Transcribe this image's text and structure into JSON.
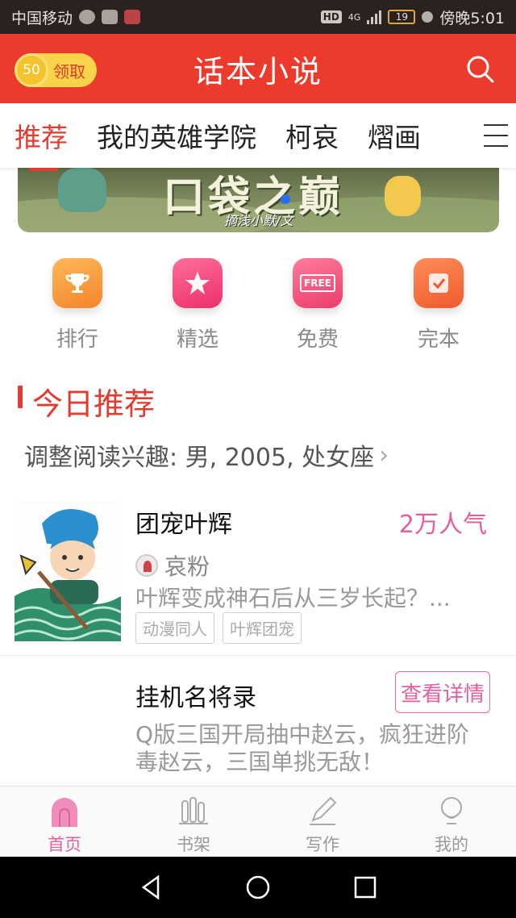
{
  "status_bar": {
    "carrier": "中国移动",
    "network": "4G",
    "hd_label": "HD",
    "battery": "19",
    "time": "傍晚5:01"
  },
  "header": {
    "coins": "50",
    "coin_action": "领取",
    "title": "话本小说",
    "search_icon": "search-icon"
  },
  "tabs": [
    {
      "label": "推荐",
      "active": true
    },
    {
      "label": "我的英雄学院",
      "active": false
    },
    {
      "label": "柯哀",
      "active": false
    },
    {
      "label": "熠画",
      "active": false
    }
  ],
  "banner": {
    "title": "口袋之巅",
    "subtitle": "摘浅小默/文"
  },
  "categories": [
    {
      "label": "排行",
      "icon": "trophy-icon",
      "color": "#f79a3a"
    },
    {
      "label": "精选",
      "icon": "star-icon",
      "color": "#f0467c"
    },
    {
      "label": "免费",
      "icon": "free-icon",
      "icon_text": "FREE",
      "color": "#f04f78"
    },
    {
      "label": "完本",
      "icon": "checklist-icon",
      "color": "#f06d3c"
    }
  ],
  "today": {
    "title": "今日推荐",
    "interest_text": "调整阅读兴趣: 男, 2005, 处女座",
    "arrow": "›"
  },
  "books": [
    {
      "title": "团宠叶辉",
      "popularity": "2万人气",
      "author": "哀粉",
      "description": "叶辉变成神石后从三岁长起？...",
      "tags": [
        "动漫同人",
        "叶辉团宠"
      ]
    },
    {
      "title": "挂机名将录",
      "action": "查看详情",
      "description_line1": "Q版三国开局抽中赵云，疯狂进阶",
      "description_line2": "毒赵云，三国单挑无敌！"
    }
  ],
  "bottom_nav": [
    {
      "label": "首页",
      "icon": "home-icon",
      "active": true
    },
    {
      "label": "书架",
      "icon": "bookshelf-icon",
      "active": false
    },
    {
      "label": "写作",
      "icon": "pen-icon",
      "active": false
    },
    {
      "label": "我的",
      "icon": "profile-icon",
      "active": false
    }
  ],
  "colors": {
    "header_red": "#ec3b2d",
    "accent_red": "#e33b2f",
    "accent_pink": "#e360a0",
    "coin_yellow": "#f9d34a"
  }
}
